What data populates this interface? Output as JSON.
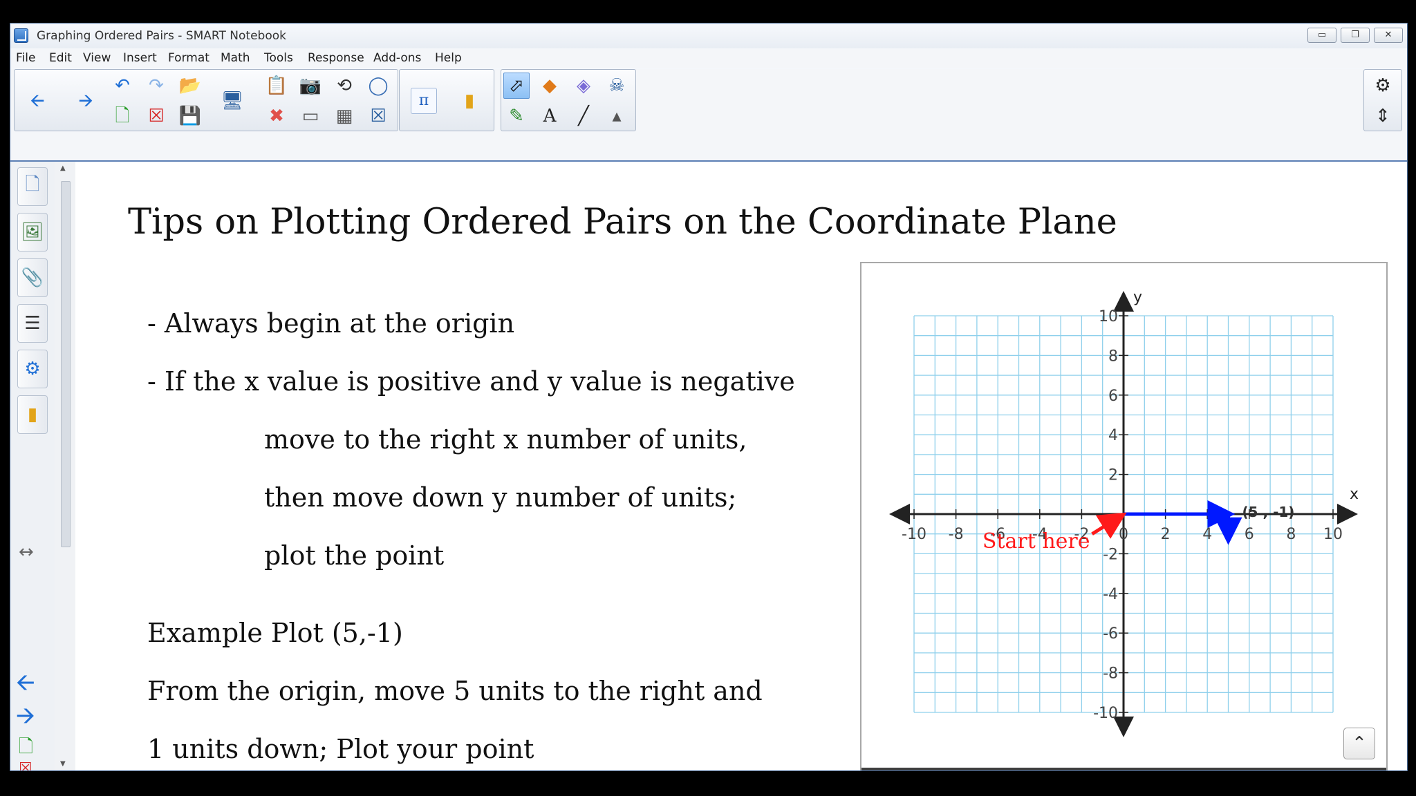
{
  "window": {
    "title": "Graphing Ordered Pairs - SMART Notebook",
    "buttons": [
      "▭",
      "❐",
      "✕"
    ]
  },
  "menu": [
    "File",
    "Edit",
    "View",
    "Insert",
    "Format",
    "Math",
    "Tools",
    "Response",
    "Add-ons",
    "Help"
  ],
  "toolbar": {
    "icons": {
      "back": "arrow-left-icon",
      "forward": "arrow-right-icon",
      "undo": "undo-icon",
      "redo": "redo-icon",
      "open": "open-folder-icon",
      "new_page": "new-page-icon",
      "delete_page": "delete-page-icon",
      "save": "save-icon",
      "display": "display-icon",
      "paste": "paste-icon",
      "delete": "delete-icon",
      "screenshade": "screen-shade-icon",
      "capture": "screen-capture-icon",
      "table": "table-icon",
      "fullscreen": "fullscreen-icon",
      "record": "record-icon",
      "math": "math-tools-icon",
      "addon": "addon-icon",
      "select": "select-pointer-icon",
      "shapes": "shapes-icon",
      "magic_pen": "magic-pen-icon",
      "fill": "fill-icon",
      "pens": "pens-icon",
      "text": "text-icon",
      "lines": "line-icon",
      "eraser": "eraser-icon",
      "settings": "settings-gear-icon",
      "move_toolbar": "move-toolbar-icon"
    },
    "math_label": "π"
  },
  "sidebar": {
    "tabs": [
      "page-sorter-icon",
      "gallery-icon",
      "attachments-icon",
      "properties-icon",
      "addons-icon",
      "lesson-activity-icon"
    ],
    "bottom": [
      "previous-page-icon",
      "next-page-icon",
      "add-page-icon",
      "delete-page-icon"
    ]
  },
  "page": {
    "title": "Tips on Plotting Ordered Pairs on the Coordinate Plane",
    "lines": [
      "- Always begin at the origin",
      "- If the x value is positive and y value is negative",
      "move to the right x number of units,",
      "then move down y number of units;",
      "plot the point",
      "Example Plot (5,-1)",
      "From the origin, move 5 units to the right and",
      "1 units down; Plot your point"
    ]
  },
  "graph": {
    "x_label": "x",
    "y_label": "y",
    "xlim": [
      -10,
      10
    ],
    "ylim": [
      -10,
      10
    ],
    "tick_step": 2,
    "x_ticks": [
      "-10",
      "-8",
      "-6",
      "-4",
      "-2",
      "0",
      "2",
      "4",
      "6",
      "8",
      "10"
    ],
    "y_ticks": [
      "10",
      "8",
      "6",
      "4",
      "2",
      "-2",
      "-4",
      "-6",
      "-8",
      "-10"
    ],
    "point_label": "(5 , -1)",
    "point": [
      5,
      -1
    ],
    "start_label": "Start here",
    "grid_color": "#8fd0ec",
    "horizontal_move_color": "#0018ff",
    "start_arrow_color": "#ff1a1a"
  }
}
